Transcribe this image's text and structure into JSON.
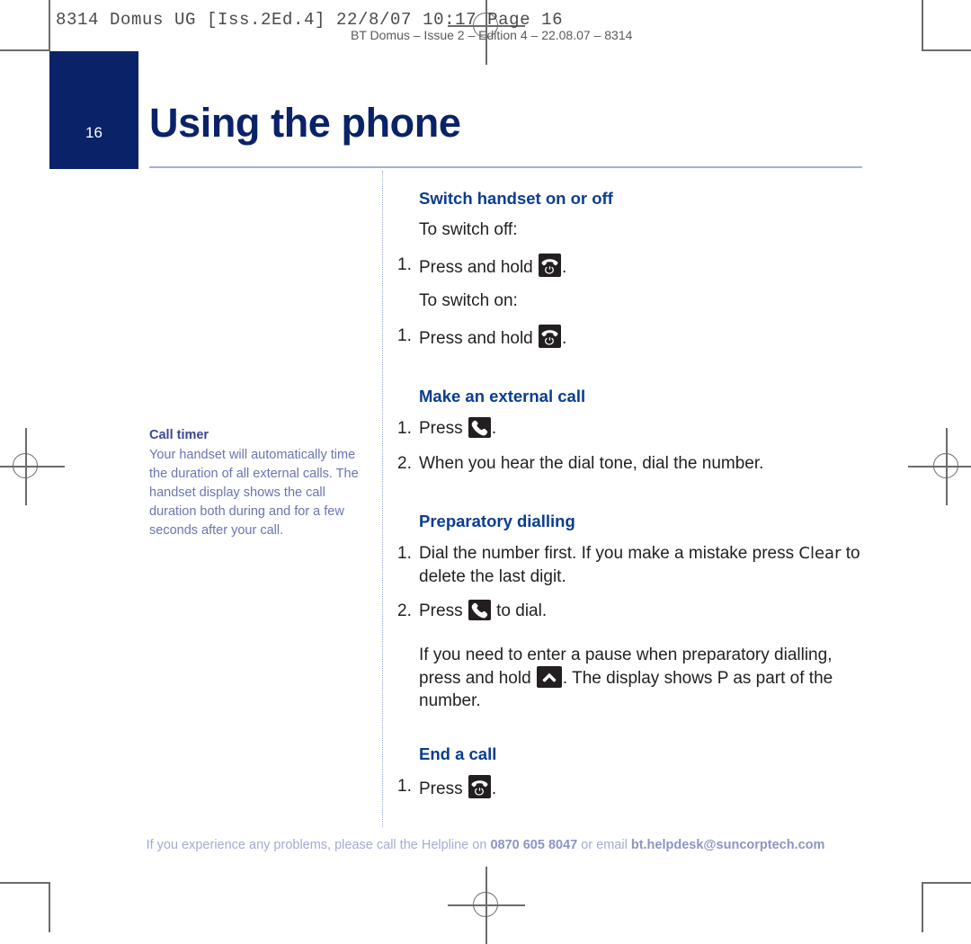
{
  "press_marks": {
    "header_line": "8314 Domus UG [Iss.2Ed.4]  22/8/07  10:17  Page 16",
    "sub_line": "BT Domus – Issue 2 – Edition 4 – 22.08.07 – 8314"
  },
  "header": {
    "page_number": "16",
    "title": "Using the phone",
    "navy": "#0a2268",
    "rule_color": "#a9b0d4"
  },
  "side_note": {
    "title": "Call timer",
    "body": "Your handset will automatically time the duration of all external calls. The handset display shows the call duration both during and for a few seconds after your call.",
    "color": "#6b74b4"
  },
  "sections": [
    {
      "id": "switch-handset-on-or-off",
      "heading": "Switch handset on or off",
      "blocks": [
        {
          "type": "plain",
          "text": "To switch off:"
        },
        {
          "type": "step",
          "num": "1.",
          "pre": "Press and hold ",
          "icon": "end-call-power-key-icon",
          "post": "."
        },
        {
          "type": "plain",
          "text": "To switch on:"
        },
        {
          "type": "step",
          "num": "1.",
          "pre": "Press and hold ",
          "icon": "end-call-power-key-icon",
          "post": "."
        }
      ]
    },
    {
      "id": "make-an-external-call",
      "heading": "Make an external call",
      "blocks": [
        {
          "type": "step",
          "num": "1.",
          "pre": "Press ",
          "icon": "call-key-icon",
          "post": "."
        },
        {
          "type": "step",
          "num": "2.",
          "pre": "When you hear the dial tone, dial the number.",
          "icon": "",
          "post": ""
        }
      ]
    },
    {
      "id": "preparatory-dialling",
      "heading": "Preparatory dialling",
      "blocks": [
        {
          "type": "step",
          "num": "1.",
          "pre": "Dial the number first. If you make a mistake press ",
          "icon": "",
          "keyword": "Clear",
          "post": " to delete the last digit."
        },
        {
          "type": "step",
          "num": "2.",
          "pre": "Press ",
          "icon": "call-key-icon",
          "post": " to dial."
        },
        {
          "type": "note",
          "pre": "If you need to enter a pause when preparatory dialling, press and hold ",
          "icon": "up-arrow-key-icon",
          "post": ". The display shows P as part of the number."
        }
      ]
    },
    {
      "id": "end-a-call",
      "heading": "End a call",
      "blocks": [
        {
          "type": "step",
          "num": "1.",
          "pre": "Press ",
          "icon": "end-call-power-key-icon",
          "post": "."
        }
      ]
    }
  ],
  "footer": {
    "lead": "If you experience any problems, please call the Helpline on ",
    "phone": "0870 605 8047",
    "middle": " or email ",
    "email": "bt.helpdesk@suncorptech.com",
    "color": "#a4abd4"
  }
}
